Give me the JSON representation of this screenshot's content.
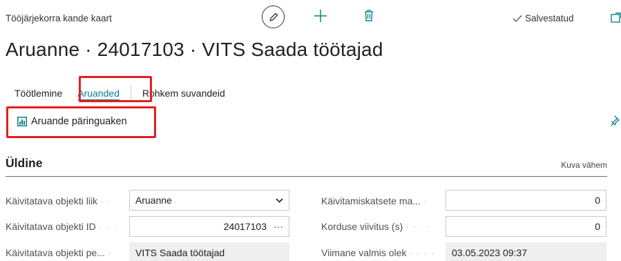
{
  "header": {
    "breadcrumb": "Tööjärjekorra kande kaart",
    "saved_label": "Salvestatud",
    "icons": [
      "edit-icon",
      "add-icon",
      "delete-icon",
      "checkmark-icon",
      "popout-icon"
    ]
  },
  "page_title": "Aruanne · 24017103 · VITS Saada töötajad",
  "tabs": {
    "processing": "Töötlemine",
    "reports": "Aruanded",
    "more": "Rohkem suvandeid"
  },
  "actions": {
    "request_page": "Aruande päringuaken"
  },
  "section": {
    "title": "Üldine",
    "show_less": "Kuva vähem"
  },
  "fields": {
    "object_type": {
      "label": "Käivitatava objekti liik",
      "value": "Aruanne"
    },
    "object_id": {
      "label": "Käivitatava objekti ID",
      "value": "24017103",
      "lookup": "···"
    },
    "object_caption": {
      "label": "Käivitatava objekti pe...",
      "value": "VITS Saada töötajad"
    },
    "max_attempts": {
      "label": "Käivitamiskatsete ma...",
      "value": "0"
    },
    "rerun_delay": {
      "label": "Korduse viivitus (s)",
      "value": "0"
    },
    "last_ready_state": {
      "label": "Viimane valmis olek",
      "value": "03.05.2023 09:37"
    }
  },
  "colors": {
    "accent": "#0a7f8a",
    "highlight": "#e41e1e"
  }
}
